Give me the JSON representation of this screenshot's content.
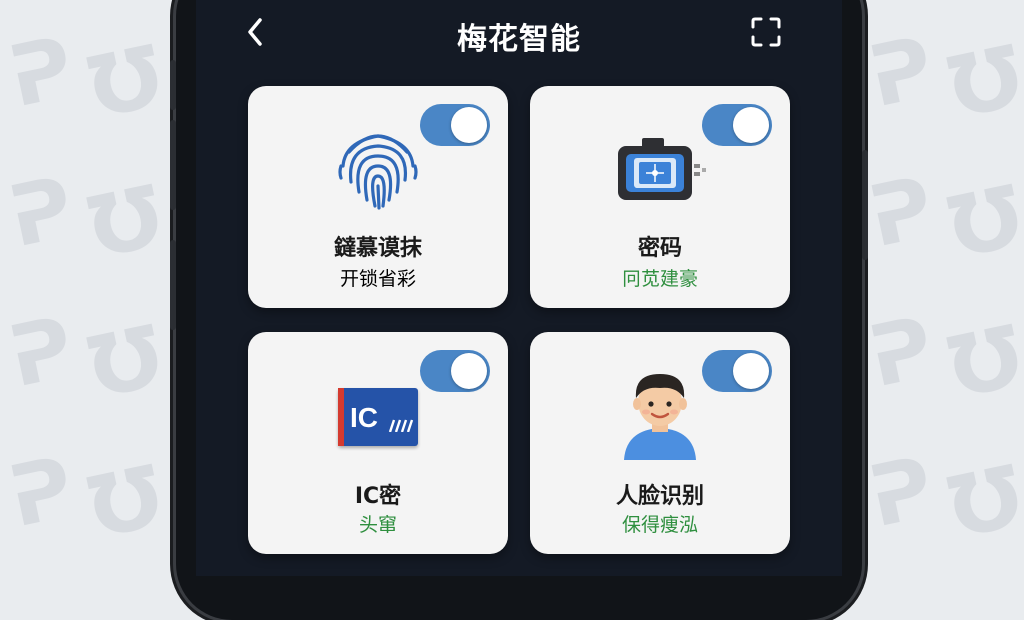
{
  "app": {
    "title": "梅花智能"
  },
  "cards": [
    {
      "name": "鐽慕谟抹",
      "status": "开锁省彩",
      "status_color": "#3a3a3a",
      "enabled": true
    },
    {
      "name": "密码",
      "status": "冋苋建豪",
      "status_color": "#2f8f3f",
      "enabled": true
    },
    {
      "name": "IC密",
      "status": "头窜",
      "status_color": "#2f8f3f",
      "enabled": true,
      "icon_text": "IC"
    },
    {
      "name": "人脸识别",
      "status": "保得痩泓",
      "status_color": "#2f8f3f",
      "enabled": true
    }
  ],
  "colors": {
    "screen_bg": "#141a25",
    "toggle_on": "#4a86c6",
    "card_bg": "#f4f4f4"
  },
  "icons": [
    "back-arrow-icon",
    "scan-icon",
    "fingerprint-icon",
    "camera-icon",
    "ic-card-icon",
    "face-avatar-icon"
  ]
}
